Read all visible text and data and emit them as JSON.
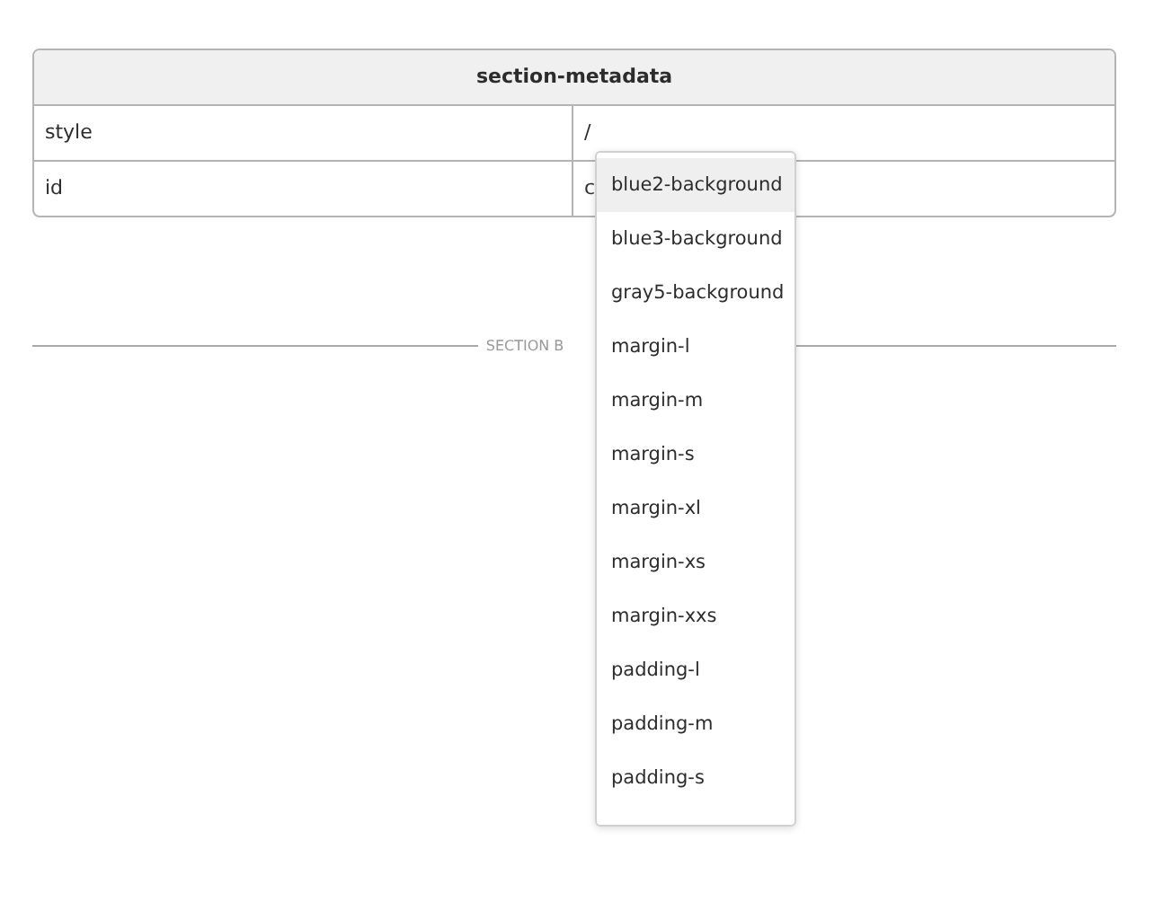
{
  "table": {
    "title": "section-metadata",
    "rows": [
      {
        "key": "style",
        "value": "/"
      },
      {
        "key": "id",
        "value": "c"
      }
    ]
  },
  "divider": {
    "label": "SECTION B"
  },
  "dropdown": {
    "options": [
      {
        "label": "blue2-background",
        "selected": true
      },
      {
        "label": "blue3-background",
        "selected": false
      },
      {
        "label": "gray5-background",
        "selected": false
      },
      {
        "label": "margin-l",
        "selected": false
      },
      {
        "label": "margin-m",
        "selected": false
      },
      {
        "label": "margin-s",
        "selected": false
      },
      {
        "label": "margin-xl",
        "selected": false
      },
      {
        "label": "margin-xs",
        "selected": false
      },
      {
        "label": "margin-xxs",
        "selected": false
      },
      {
        "label": "padding-l",
        "selected": false
      },
      {
        "label": "padding-m",
        "selected": false
      },
      {
        "label": "padding-s",
        "selected": false
      }
    ]
  }
}
